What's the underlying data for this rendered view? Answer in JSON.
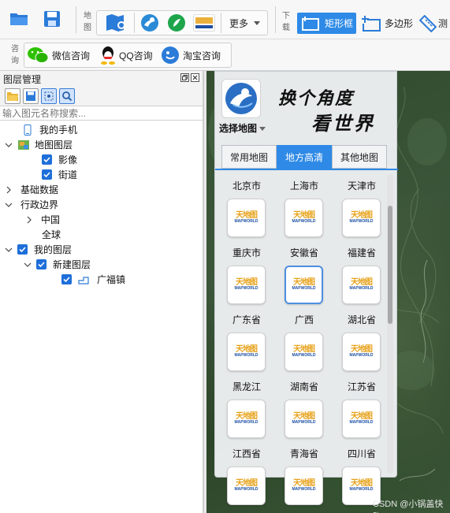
{
  "toolbar": {
    "map_group_label": "地图",
    "download_group_label": "下载",
    "more_label": "更多",
    "rect_label": "矩形框",
    "polygon_label": "多边形",
    "measure_label": "测",
    "consult_group_label": "咨询",
    "wechat_label": "微信咨询",
    "qq_label": "QQ咨询",
    "taobao_label": "淘宝咨询"
  },
  "layer_panel": {
    "title": "图层管理",
    "search_placeholder": "输入图元名称搜索...",
    "tree": [
      {
        "label": "我的手机"
      },
      {
        "label": "地图图层"
      },
      {
        "label": "影像"
      },
      {
        "label": "街道"
      },
      {
        "label": "基础数据"
      },
      {
        "label": "行政边界"
      },
      {
        "label": "中国"
      },
      {
        "label": "全球"
      },
      {
        "label": "我的图层"
      },
      {
        "label": "新建图层"
      },
      {
        "label": "广福镇"
      }
    ]
  },
  "picker": {
    "select_label": "选择地图",
    "slogan_line1": "换个角度",
    "slogan_line2": "看世界",
    "tabs": [
      "常用地图",
      "地方高清",
      "其他地图"
    ],
    "active_tab": 1,
    "thumb_text": "天地图",
    "thumb_sub": "MAPWORLD",
    "cells": [
      "北京市",
      "上海市",
      "天津市",
      "重庆市",
      "安徽省",
      "福建省",
      "广东省",
      "广西",
      "湖北省",
      "黑龙江",
      "湖南省",
      "江苏省",
      "江西省",
      "青海省",
      "四川省"
    ],
    "selected_cell": 4
  },
  "watermark": "CSDN @小锅盖快跑",
  "colors": {
    "accent": "#2e8ae6",
    "checkbox": "#1e6fd9"
  }
}
